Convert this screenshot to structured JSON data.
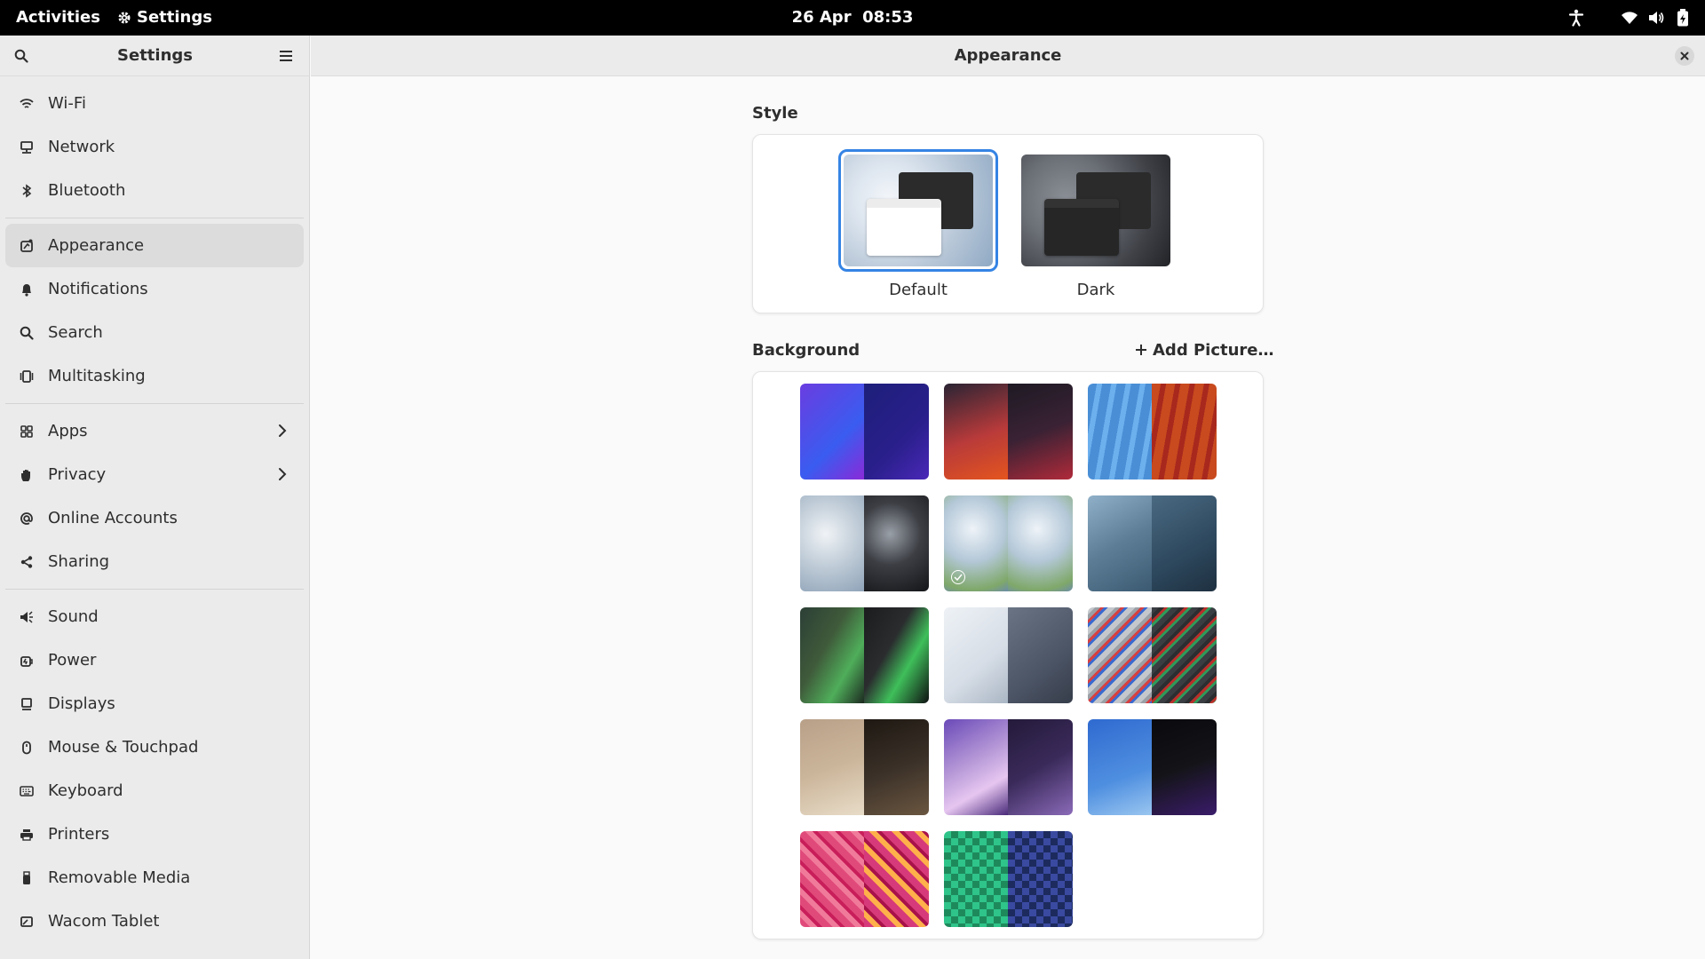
{
  "topbar": {
    "activities": "Activities",
    "app_name": "Settings",
    "date": "26 Apr",
    "time": "08:53",
    "tray_icons": [
      "accessibility-icon",
      "wifi-icon",
      "volume-icon",
      "battery-icon"
    ]
  },
  "sidebar": {
    "title": "Settings",
    "groups": [
      [
        {
          "label": "Wi-Fi",
          "icon": "wifi-icon"
        },
        {
          "label": "Network",
          "icon": "network-icon"
        },
        {
          "label": "Bluetooth",
          "icon": "bluetooth-icon"
        }
      ],
      [
        {
          "label": "Appearance",
          "icon": "appearance-icon",
          "active": true
        },
        {
          "label": "Notifications",
          "icon": "bell-icon"
        },
        {
          "label": "Search",
          "icon": "search-icon"
        },
        {
          "label": "Multitasking",
          "icon": "multitasking-icon"
        }
      ],
      [
        {
          "label": "Apps",
          "icon": "apps-icon",
          "chevron": true
        },
        {
          "label": "Privacy",
          "icon": "hand-icon",
          "chevron": true
        },
        {
          "label": "Online Accounts",
          "icon": "at-icon"
        },
        {
          "label": "Sharing",
          "icon": "share-icon"
        }
      ],
      [
        {
          "label": "Sound",
          "icon": "speaker-icon"
        },
        {
          "label": "Power",
          "icon": "power-icon"
        },
        {
          "label": "Displays",
          "icon": "display-icon"
        },
        {
          "label": "Mouse & Touchpad",
          "icon": "mouse-icon"
        },
        {
          "label": "Keyboard",
          "icon": "keyboard-icon"
        },
        {
          "label": "Printers",
          "icon": "printer-icon"
        },
        {
          "label": "Removable Media",
          "icon": "usb-icon"
        },
        {
          "label": "Wacom Tablet",
          "icon": "tablet-icon"
        }
      ]
    ]
  },
  "main": {
    "title": "Appearance",
    "style": {
      "section_label": "Style",
      "options": [
        {
          "label": "Default",
          "selected": true
        },
        {
          "label": "Dark",
          "selected": false
        }
      ]
    },
    "background": {
      "section_label": "Background",
      "add_picture_label": "Add Picture…",
      "selected_index": 4,
      "wallpapers": [
        {
          "light": "#6a3de0",
          "dark": "#2a1f8c"
        },
        {
          "light": "#b83a3a",
          "dark": "#3a2234"
        },
        {
          "light": "#4a8fd6",
          "dark": "#c84a1e"
        },
        {
          "light": "#c7d2dc",
          "dark": "#3c3e44"
        },
        {
          "light": "#b4c8d8",
          "dark": "#b4c8d8"
        },
        {
          "light": "#5d7d96",
          "dark": "#2f4a60"
        },
        {
          "light": "#3f5a3a",
          "dark": "#2a2c2e"
        },
        {
          "light": "#d6dde6",
          "dark": "#4c5566"
        },
        {
          "light": "#9aa0a6",
          "dark": "#2b2e30"
        },
        {
          "light": "#cbb59a",
          "dark": "#3a3028"
        },
        {
          "light": "#b89ad8",
          "dark": "#3a2a5a"
        },
        {
          "light": "#4f8fe0",
          "dark": "#141418"
        },
        {
          "light": "#e04a7a",
          "dark": "#d63a7a"
        },
        {
          "light": "#1e8a5c",
          "dark": "#1c2a5e"
        }
      ]
    }
  }
}
